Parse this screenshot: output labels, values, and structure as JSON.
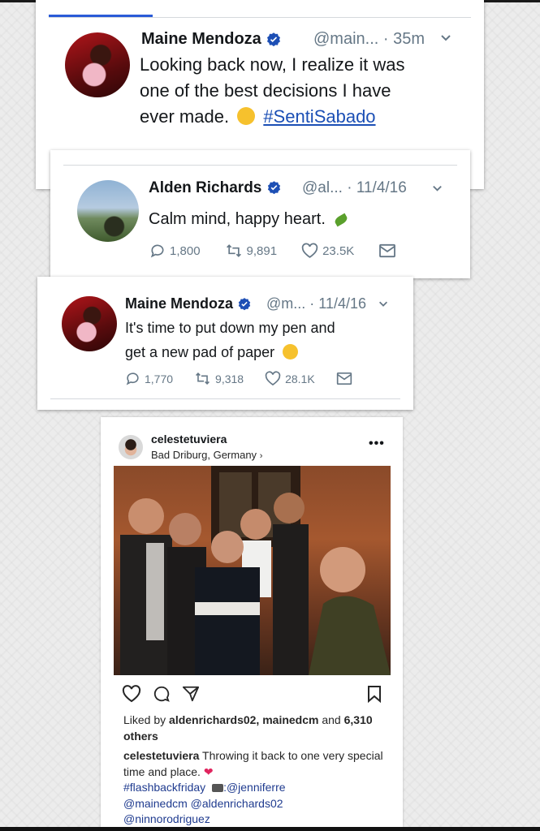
{
  "tweet1": {
    "name": "Maine Mendoza",
    "handle": "@main...",
    "time": "35m",
    "text_line1": "Looking back now, I realize it was",
    "text_line2": "one of the best decisions I have",
    "text_line3_prefix": "ever made.",
    "hashtag": "#SentiSabado"
  },
  "tweet2": {
    "name": "Alden Richards",
    "handle": "@al...",
    "time": "11/4/16",
    "text": "Calm mind, happy heart.",
    "replies": "1,800",
    "retweets": "9,891",
    "likes": "23.5K"
  },
  "tweet3": {
    "name": "Maine Mendoza",
    "handle": "@m...",
    "time": "11/4/16",
    "text_line1": "It's time to put down my pen and",
    "text_line2": "get a new pad of paper",
    "replies": "1,770",
    "retweets": "9,318",
    "likes": "28.1K"
  },
  "instagram": {
    "username": "celestetuviera",
    "location": "Bad Driburg, Germany",
    "liked_by_prefix": "Liked by",
    "liked_by_users": "aldenrichards02, mainedcm",
    "liked_by_and": "and",
    "liked_by_others": "6,310 others",
    "caption_user": "celestetuviera",
    "caption_text": "Throwing it back to one very special time and place.",
    "caption_tag": "#flashbackfriday",
    "caption_credit": ":@jenniferre",
    "caption_mentions_line1": "@mainedcm @aldenrichards02",
    "caption_mentions_line2": "@ninnorodriguez"
  },
  "colors": {
    "twitter_gray": "#657786",
    "verified_blue": "#1d4fb5",
    "link_blue": "#1f3b8f",
    "heart_red": "#e0245e"
  }
}
